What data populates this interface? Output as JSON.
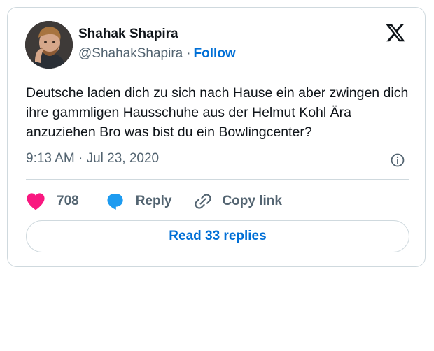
{
  "author": {
    "name": "Shahak Shapira",
    "handle": "@ShahakShapira",
    "separator": "·",
    "follow_label": "Follow",
    "avatar_icon": "avatar-photo"
  },
  "brand": {
    "logo_icon": "x-logo-icon",
    "color": "#0f1419"
  },
  "tweet": {
    "text": "Deutsche laden dich zu sich nach Hause ein aber zwingen dich ihre gammligen Hausschuhe aus der Helmut Kohl Ära anzuziehen Bro was bist du ein Bowlingcenter?",
    "timestamp": "9:13 AM · Jul 23, 2020",
    "info_icon": "info-icon"
  },
  "actions": {
    "like_count": "708",
    "like_icon": "heart-icon",
    "like_color": "#f91880",
    "reply_label": "Reply",
    "reply_icon": "speech-bubble-icon",
    "reply_color": "#1d9bf0",
    "copy_label": "Copy link",
    "copy_icon": "link-icon"
  },
  "footer": {
    "read_replies_label": "Read 33 replies",
    "accent_color": "#006fd6"
  }
}
